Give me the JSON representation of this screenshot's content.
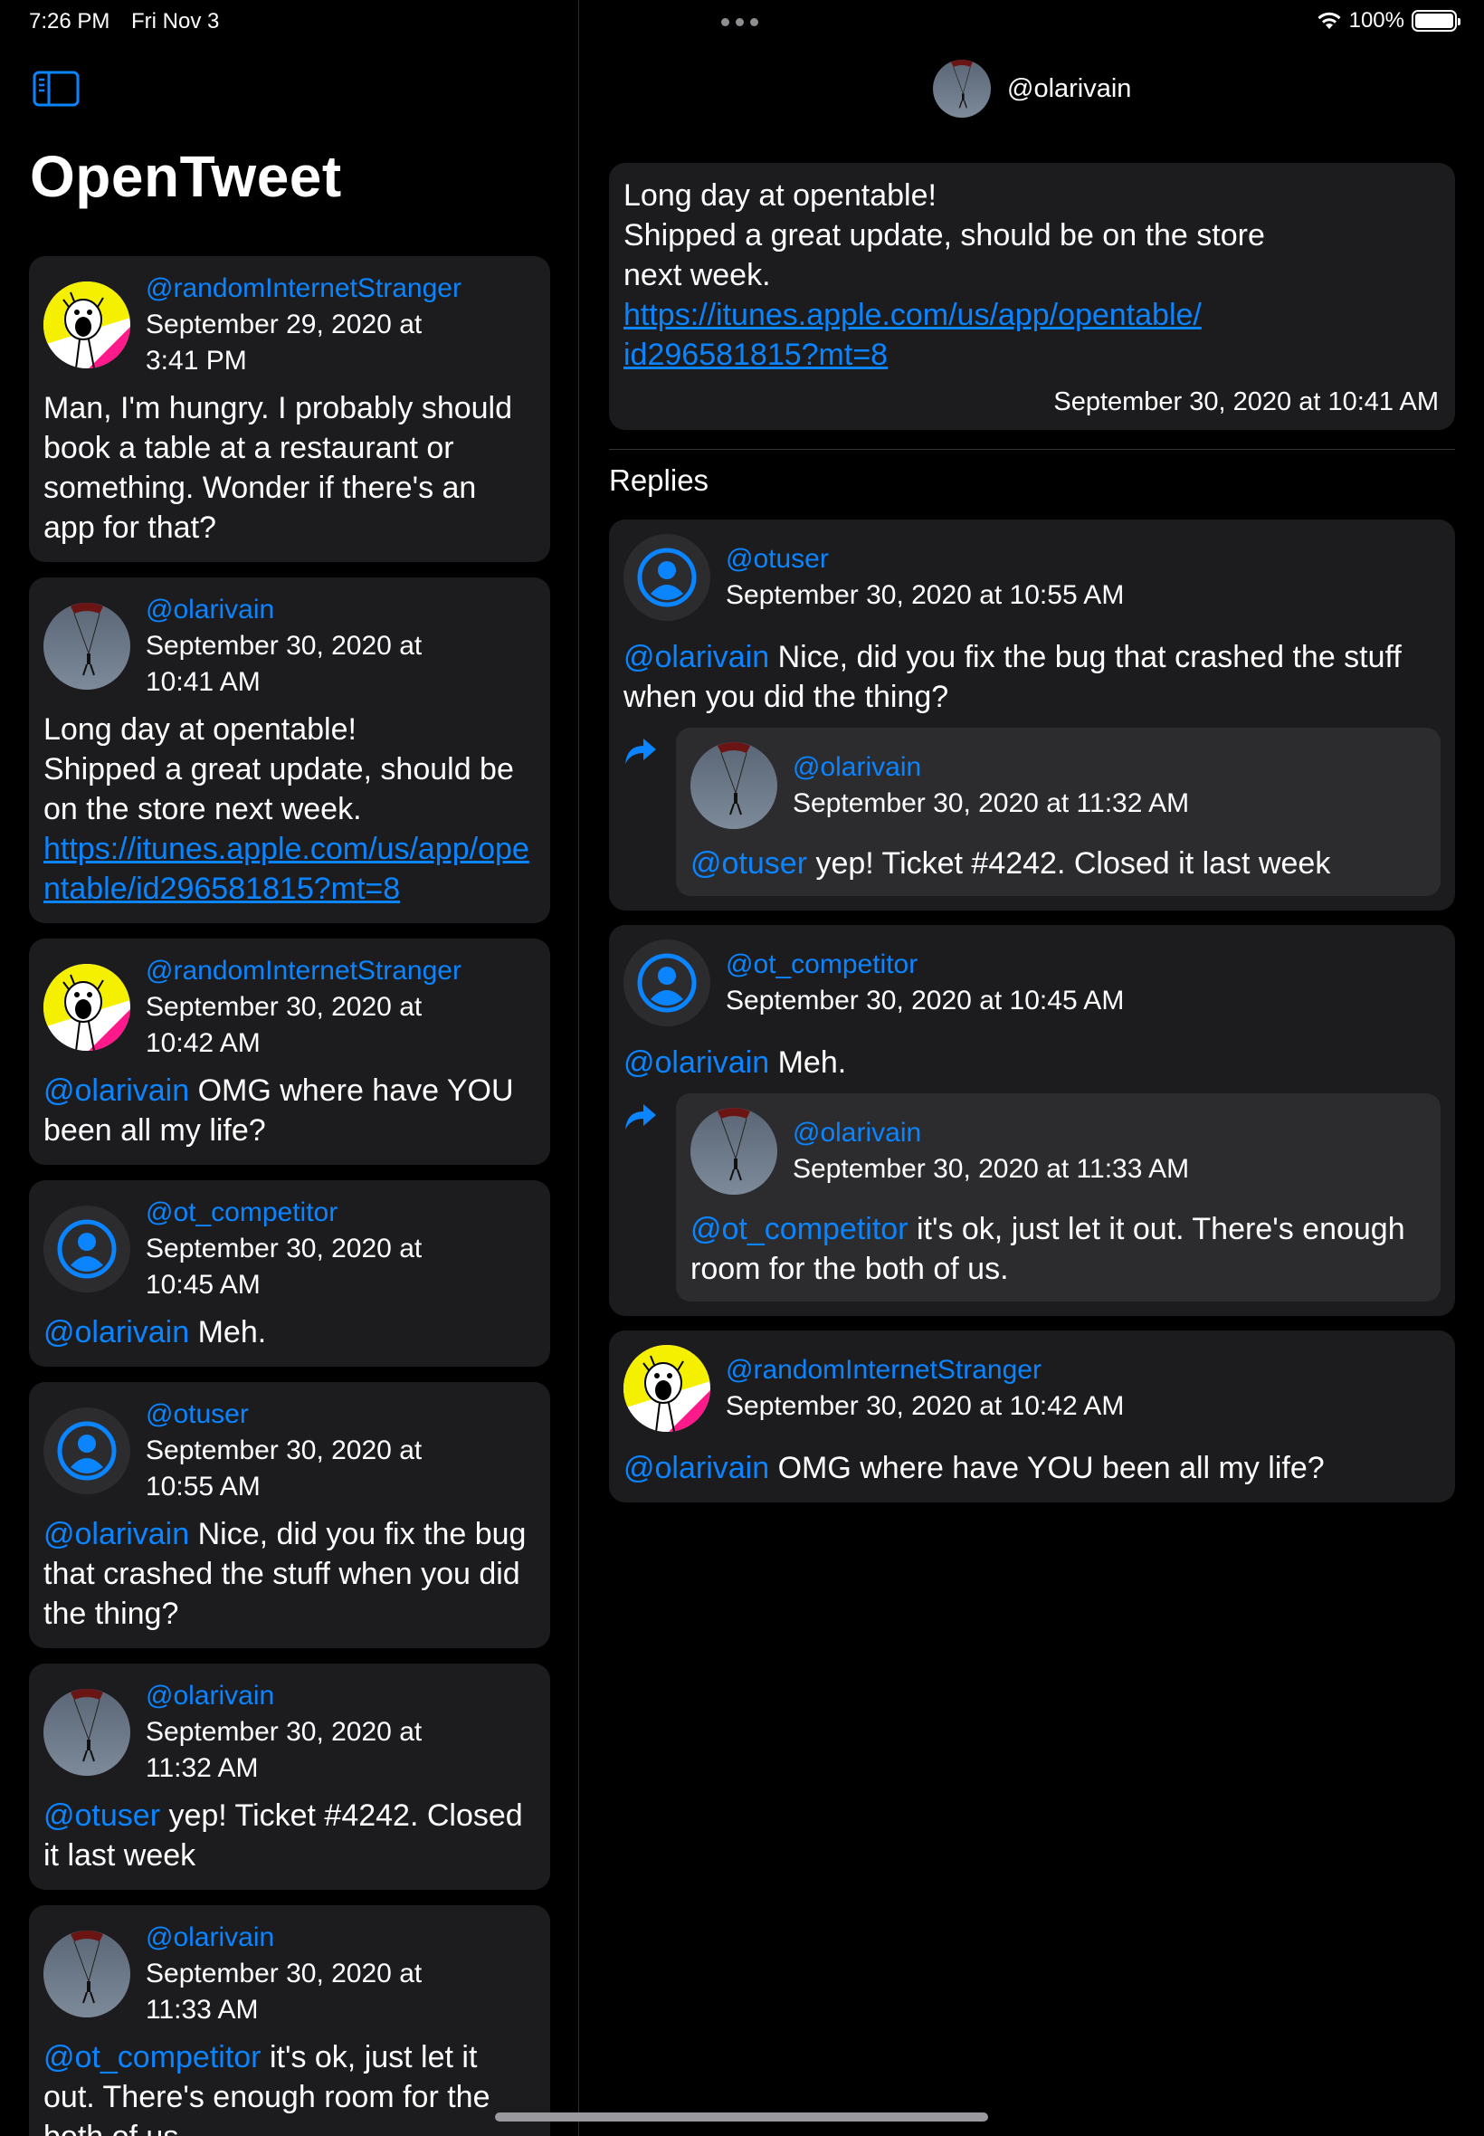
{
  "status_bar": {
    "time": "7:26 PM",
    "date": "Fri Nov 3",
    "battery": "100%",
    "battery_level": 1.0
  },
  "sidebar": {
    "title": "OpenTweet",
    "tweets": [
      {
        "handle": "@randomInternetStranger",
        "date": "September 29, 2020 at\n3:41 PM",
        "avatar": "meme-avatar",
        "mention": "",
        "text": "Man, I'm hungry. I probably should book a table at a restaurant or something. Wonder if there's an app for that?",
        "link": ""
      },
      {
        "handle": "@olarivain",
        "date": "September 30, 2020 at\n10:41 AM",
        "avatar": "parachute-avatar",
        "mention": "",
        "text": "Long day at opentable!\nShipped a great update, should be on the store next week.",
        "link": "https://itunes.apple.com/us/app/opentable/id296581815?mt=8"
      },
      {
        "handle": "@randomInternetStranger",
        "date": "September 30, 2020 at\n10:42 AM",
        "avatar": "meme-avatar",
        "mention": "@olarivain",
        "text": " OMG where have YOU been all my life?",
        "link": ""
      },
      {
        "handle": "@ot_competitor",
        "date": "September 30, 2020 at\n10:45 AM",
        "avatar": "person-circle-icon",
        "mention": "@olarivain",
        "text": " Meh.",
        "link": ""
      },
      {
        "handle": "@otuser",
        "date": "September 30, 2020 at\n10:55 AM",
        "avatar": "person-circle-icon",
        "mention": "@olarivain",
        "text": " Nice, did you fix the bug that crashed the stuff when you did the thing?",
        "link": ""
      },
      {
        "handle": "@olarivain",
        "date": "September 30, 2020 at\n11:32 AM",
        "avatar": "parachute-avatar",
        "mention": "@otuser",
        "text": " yep! Ticket #4242. Closed it last week",
        "link": ""
      },
      {
        "handle": "@olarivain",
        "date": "September 30, 2020 at\n11:33 AM",
        "avatar": "parachute-avatar",
        "mention": "@ot_competitor",
        "text": " it's ok, just let it out. There's enough room for the both of us.",
        "link": ""
      }
    ]
  },
  "detail": {
    "nav_handle": "@olarivain",
    "main_tweet": {
      "text": "Long day at opentable!\nShipped a great update, should be on the store\nnext week.",
      "link": "https://itunes.apple.com/us/app/opentable/\nid296581815?mt=8",
      "date": "September 30, 2020 at 10:41 AM"
    },
    "replies_label": "Replies",
    "replies": [
      {
        "handle": "@otuser",
        "date": "September 30, 2020 at 10:55 AM",
        "avatar": "person-circle-icon",
        "mention": "@olarivain",
        "text": " Nice, did you fix the bug that crashed the stuff when you did the thing?",
        "nested": {
          "handle": "@olarivain",
          "date": "September 30, 2020 at 11:32 AM",
          "avatar": "parachute-avatar",
          "mention": "@otuser",
          "text": " yep! Ticket #4242. Closed it last week"
        }
      },
      {
        "handle": "@ot_competitor",
        "date": "September 30, 2020 at 10:45 AM",
        "avatar": "person-circle-icon",
        "mention": "@olarivain",
        "text": " Meh.",
        "nested": {
          "handle": "@olarivain",
          "date": "September 30, 2020 at 11:33 AM",
          "avatar": "parachute-avatar",
          "mention": "@ot_competitor",
          "text": " it's ok, just let it out. There's enough room for the both of us."
        }
      },
      {
        "handle": "@randomInternetStranger",
        "date": "September 30, 2020 at 10:42 AM",
        "avatar": "meme-avatar",
        "mention": "@olarivain",
        "text": " OMG where have YOU been all my life?"
      }
    ]
  },
  "colors": {
    "accent": "#0a84ff",
    "card": "#1c1c1e",
    "nested_card": "#2c2c2e",
    "background": "#000000"
  }
}
